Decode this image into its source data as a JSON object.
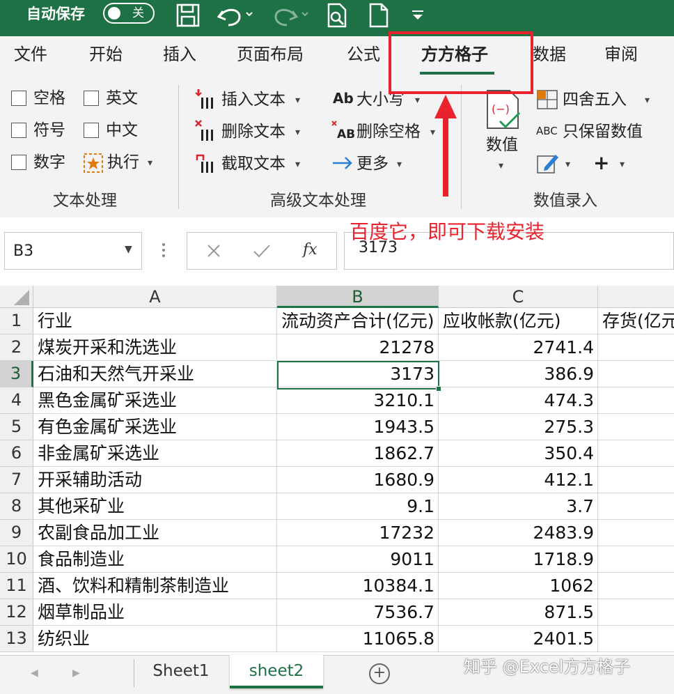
{
  "titlebar": {
    "autosave_label": "自动保存",
    "autosave_state": "关",
    "icons": [
      "save-icon",
      "undo-icon",
      "redo-icon",
      "print-preview-icon",
      "new-file-icon",
      "customize-icon"
    ]
  },
  "tabs": [
    {
      "label": "文件"
    },
    {
      "label": "开始"
    },
    {
      "label": "插入"
    },
    {
      "label": "页面布局"
    },
    {
      "label": "公式"
    },
    {
      "label": "方方格子",
      "active": true
    },
    {
      "label": "数据"
    },
    {
      "label": "审阅"
    }
  ],
  "ribbon": {
    "text_group": {
      "label": "文本处理",
      "checkboxes": [
        "空格",
        "英文",
        "符号",
        "中文",
        "数字"
      ],
      "execute": "执行"
    },
    "adv_group": {
      "label": "高级文本处理",
      "insert_text": "插入文本",
      "delete_text": "删除文本",
      "extract_text": "截取文本",
      "case": "大小写",
      "delete_space": "删除空格",
      "more": "更多"
    },
    "num_group": {
      "label": "数值录入",
      "value_btn": "数值",
      "round": "四舍五入",
      "keep_value": "只保留数值"
    }
  },
  "annotation": "百度它，即可下载安装",
  "formula_bar": {
    "name_box": "B3",
    "fx": "fx",
    "value": "3173"
  },
  "sheet": {
    "columns": [
      "A",
      "B",
      "C",
      ""
    ],
    "rows": [
      {
        "n": "1",
        "a": "行业",
        "b": "流动资产合计(亿元)",
        "c": "应收帐款(亿元)",
        "d": "存货(亿元)"
      },
      {
        "n": "2",
        "a": "煤炭开采和洗选业",
        "b": "21278",
        "c": "2741.4",
        "d": ""
      },
      {
        "n": "3",
        "a": "石油和天然气开采业",
        "b": "3173",
        "c": "386.9",
        "d": ""
      },
      {
        "n": "4",
        "a": "黑色金属矿采选业",
        "b": "3210.1",
        "c": "474.3",
        "d": ""
      },
      {
        "n": "5",
        "a": "有色金属矿采选业",
        "b": "1943.5",
        "c": "275.3",
        "d": ""
      },
      {
        "n": "6",
        "a": "非金属矿采选业",
        "b": "1862.7",
        "c": "350.4",
        "d": ""
      },
      {
        "n": "7",
        "a": "开采辅助活动",
        "b": "1680.9",
        "c": "412.1",
        "d": ""
      },
      {
        "n": "8",
        "a": "其他采矿业",
        "b": "9.1",
        "c": "3.7",
        "d": ""
      },
      {
        "n": "9",
        "a": "农副食品加工业",
        "b": "17232",
        "c": "2483.9",
        "d": ""
      },
      {
        "n": "10",
        "a": "食品制造业",
        "b": "9011",
        "c": "1718.9",
        "d": ""
      },
      {
        "n": "11",
        "a": "酒、饮料和精制茶制造业",
        "b": "10384.1",
        "c": "1062",
        "d": ""
      },
      {
        "n": "12",
        "a": "烟草制品业",
        "b": "7536.7",
        "c": "871.5",
        "d": ""
      },
      {
        "n": "13",
        "a": "纺织业",
        "b": "11065.8",
        "c": "2401.5",
        "d": ""
      }
    ]
  },
  "sheet_tabs": {
    "tabs": [
      {
        "label": "Sheet1"
      },
      {
        "label": "sheet2",
        "active": true
      }
    ],
    "add_label": "+"
  },
  "watermark": "知乎 @Excel方方格子",
  "colors": {
    "accent": "#1e7145",
    "annotation": "#e8232d"
  }
}
